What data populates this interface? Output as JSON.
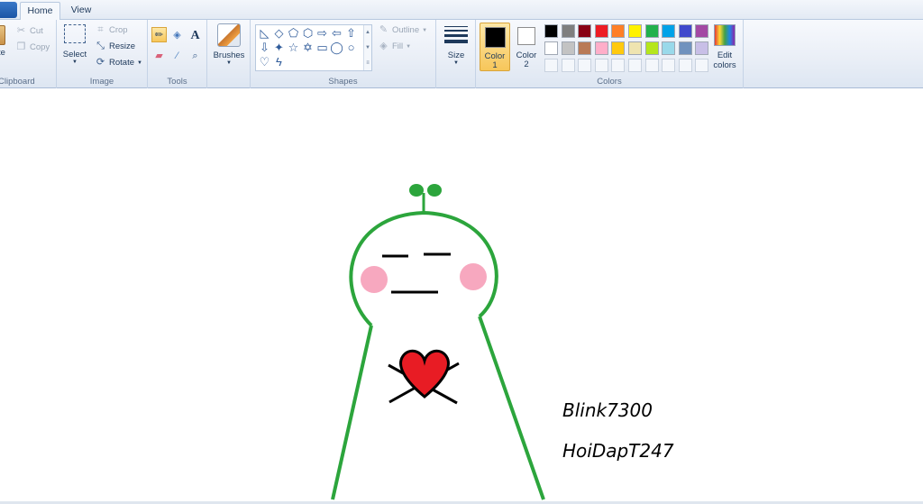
{
  "tabs": {
    "home": "Home",
    "view": "View"
  },
  "clipboard": {
    "paste_partial": "te",
    "cut": "Cut",
    "copy": "Copy",
    "label": "Clipboard"
  },
  "image": {
    "select": "Select",
    "crop": "Crop",
    "resize": "Resize",
    "rotate": "Rotate",
    "label": "Image"
  },
  "tools": {
    "label": "Tools"
  },
  "brushes": {
    "label": "Brushes"
  },
  "shapes": {
    "outline": "Outline",
    "fill": "Fill",
    "label": "Shapes"
  },
  "size": {
    "label": "Size"
  },
  "colors": {
    "color1_label_line1": "Color",
    "color1_label_line2": "1",
    "color2_label_line1": "Color",
    "color2_label_line2": "2",
    "edit_line1": "Edit",
    "edit_line2": "colors",
    "label": "Colors",
    "color1_value": "#000000",
    "color2_value": "#ffffff",
    "palette_row1": [
      "#000000",
      "#7f7f7f",
      "#880015",
      "#ed1c24",
      "#ff7f27",
      "#fff200",
      "#22b14c",
      "#00a2e8",
      "#3f48cc",
      "#a349a4"
    ],
    "palette_row2": [
      "#ffffff",
      "#c3c3c3",
      "#b97a57",
      "#ffaec9",
      "#ffc90e",
      "#efe4b0",
      "#b5e61d",
      "#99d9ea",
      "#7092be",
      "#c8bfe7"
    ]
  },
  "canvas": {
    "text_line1": "Blink7300",
    "text_line2": "HoiDapT247",
    "stroke_color": "#2ca53c",
    "heart_color": "#e81c24",
    "cheek_color": "#f7a8bf"
  }
}
